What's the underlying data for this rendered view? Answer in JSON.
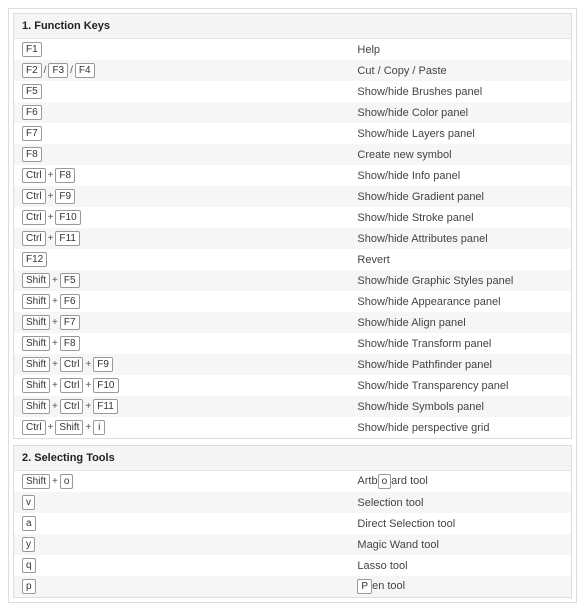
{
  "sections": [
    {
      "title": "1. Function Keys",
      "rows": [
        {
          "keys": [
            [
              "F1"
            ]
          ],
          "desc": "Help"
        },
        {
          "keys": [
            [
              "F2"
            ],
            [
              "F3"
            ],
            [
              "F4"
            ]
          ],
          "sep": "slash",
          "desc": "Cut / Copy / Paste"
        },
        {
          "keys": [
            [
              "F5"
            ]
          ],
          "desc": "Show/hide Brushes panel"
        },
        {
          "keys": [
            [
              "F6"
            ]
          ],
          "desc": "Show/hide Color panel"
        },
        {
          "keys": [
            [
              "F7"
            ]
          ],
          "desc": "Show/hide Layers panel"
        },
        {
          "keys": [
            [
              "F8"
            ]
          ],
          "desc": "Create new symbol"
        },
        {
          "keys": [
            [
              "Ctrl",
              "F8"
            ]
          ],
          "desc": "Show/hide Info panel"
        },
        {
          "keys": [
            [
              "Ctrl",
              "F9"
            ]
          ],
          "desc": "Show/hide Gradient panel"
        },
        {
          "keys": [
            [
              "Ctrl",
              "F10"
            ]
          ],
          "desc": "Show/hide Stroke panel"
        },
        {
          "keys": [
            [
              "Ctrl",
              "F11"
            ]
          ],
          "desc": "Show/hide Attributes panel"
        },
        {
          "keys": [
            [
              "F12"
            ]
          ],
          "desc": "Revert"
        },
        {
          "keys": [
            [
              "Shift",
              "F5"
            ]
          ],
          "desc": "Show/hide Graphic Styles panel"
        },
        {
          "keys": [
            [
              "Shift",
              "F6"
            ]
          ],
          "desc": "Show/hide Appearance panel"
        },
        {
          "keys": [
            [
              "Shift",
              "F7"
            ]
          ],
          "desc": "Show/hide Align panel"
        },
        {
          "keys": [
            [
              "Shift",
              "F8"
            ]
          ],
          "desc": "Show/hide Transform panel"
        },
        {
          "keys": [
            [
              "Shift",
              "Ctrl",
              "F9"
            ]
          ],
          "desc": "Show/hide Pathfinder panel"
        },
        {
          "keys": [
            [
              "Shift",
              "Ctrl",
              "F10"
            ]
          ],
          "desc": "Show/hide Transparency panel"
        },
        {
          "keys": [
            [
              "Shift",
              "Ctrl",
              "F11"
            ]
          ],
          "desc": "Show/hide Symbols panel"
        },
        {
          "keys": [
            [
              "Ctrl",
              "Shift",
              "i"
            ]
          ],
          "desc": "Show/hide perspective grid"
        }
      ]
    },
    {
      "title": "2. Selecting Tools",
      "rows": [
        {
          "keys": [
            [
              "Shift",
              "o"
            ]
          ],
          "desc_parts": [
            "Artb",
            "o",
            "ard tool"
          ]
        },
        {
          "keys": [
            [
              "v"
            ]
          ],
          "desc": "Selection tool"
        },
        {
          "keys": [
            [
              "a"
            ]
          ],
          "desc": "Direct Selection tool"
        },
        {
          "keys": [
            [
              "y"
            ]
          ],
          "desc": "Magic Wand tool"
        },
        {
          "keys": [
            [
              "q"
            ]
          ],
          "desc": "Lasso tool"
        },
        {
          "keys": [
            [
              "p"
            ]
          ],
          "desc_parts": [
            "",
            "P",
            "en tool"
          ]
        }
      ]
    }
  ]
}
